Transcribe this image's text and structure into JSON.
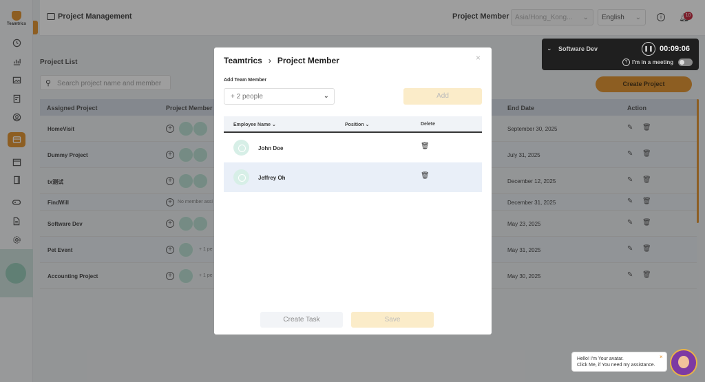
{
  "app": {
    "logo_text": "Teamtrics"
  },
  "header": {
    "title": "Project Management",
    "project_member_label": "Project Member",
    "timezone": "Asia/Hong_Kong...",
    "language": "English",
    "notification_count": "10"
  },
  "page": {
    "list_title": "Project List",
    "search_placeholder": "Search project name and member",
    "create_button": "Create Project"
  },
  "table": {
    "headers": {
      "assigned_project": "Assigned Project",
      "project_member": "Project Member",
      "end_date": "End Date",
      "action": "Action"
    },
    "rows": [
      {
        "name": "HomeVisit",
        "members_note": "",
        "end_date": "September 30, 2025"
      },
      {
        "name": "Dummy Project",
        "members_note": "",
        "end_date": "July 31, 2025"
      },
      {
        "name": "tx测试",
        "members_note": "",
        "end_date": "December 12, 2025"
      },
      {
        "name": "FindWill",
        "members_note": "No member assi",
        "end_date": "December 31, 2025"
      },
      {
        "name": "Software Dev",
        "members_note": "",
        "end_date": "May 23, 2025"
      },
      {
        "name": "Pet Event",
        "members_note": "+ 1 pe",
        "end_date": "May 31, 2025"
      },
      {
        "name": "Accounting Project",
        "members_note": "+ 1 pe",
        "end_date": "May 30, 2025"
      }
    ]
  },
  "meeting_widget": {
    "project": "Software Dev",
    "timer": "00:09:06",
    "meeting_label": "I'm in a meeting"
  },
  "modal": {
    "breadcrumb_root": "Teamtrics",
    "breadcrumb_current": "Project Member",
    "add_team_member_label": "Add Team Member",
    "select_value": "+ 2 people",
    "add_button": "Add",
    "columns": {
      "employee_name": "Employee Name",
      "position": "Position",
      "delete": "Delete"
    },
    "members": [
      {
        "name": "John Doe"
      },
      {
        "name": "Jeffrey Oh"
      }
    ],
    "create_task_button": "Create Task",
    "save_button": "Save"
  },
  "assistant": {
    "line1": "Hello! I'm Your avatar.",
    "line2": "Click Me, if You need my assistance."
  },
  "colors": {
    "accent": "#e08a1e",
    "badge": "#c0152c"
  }
}
